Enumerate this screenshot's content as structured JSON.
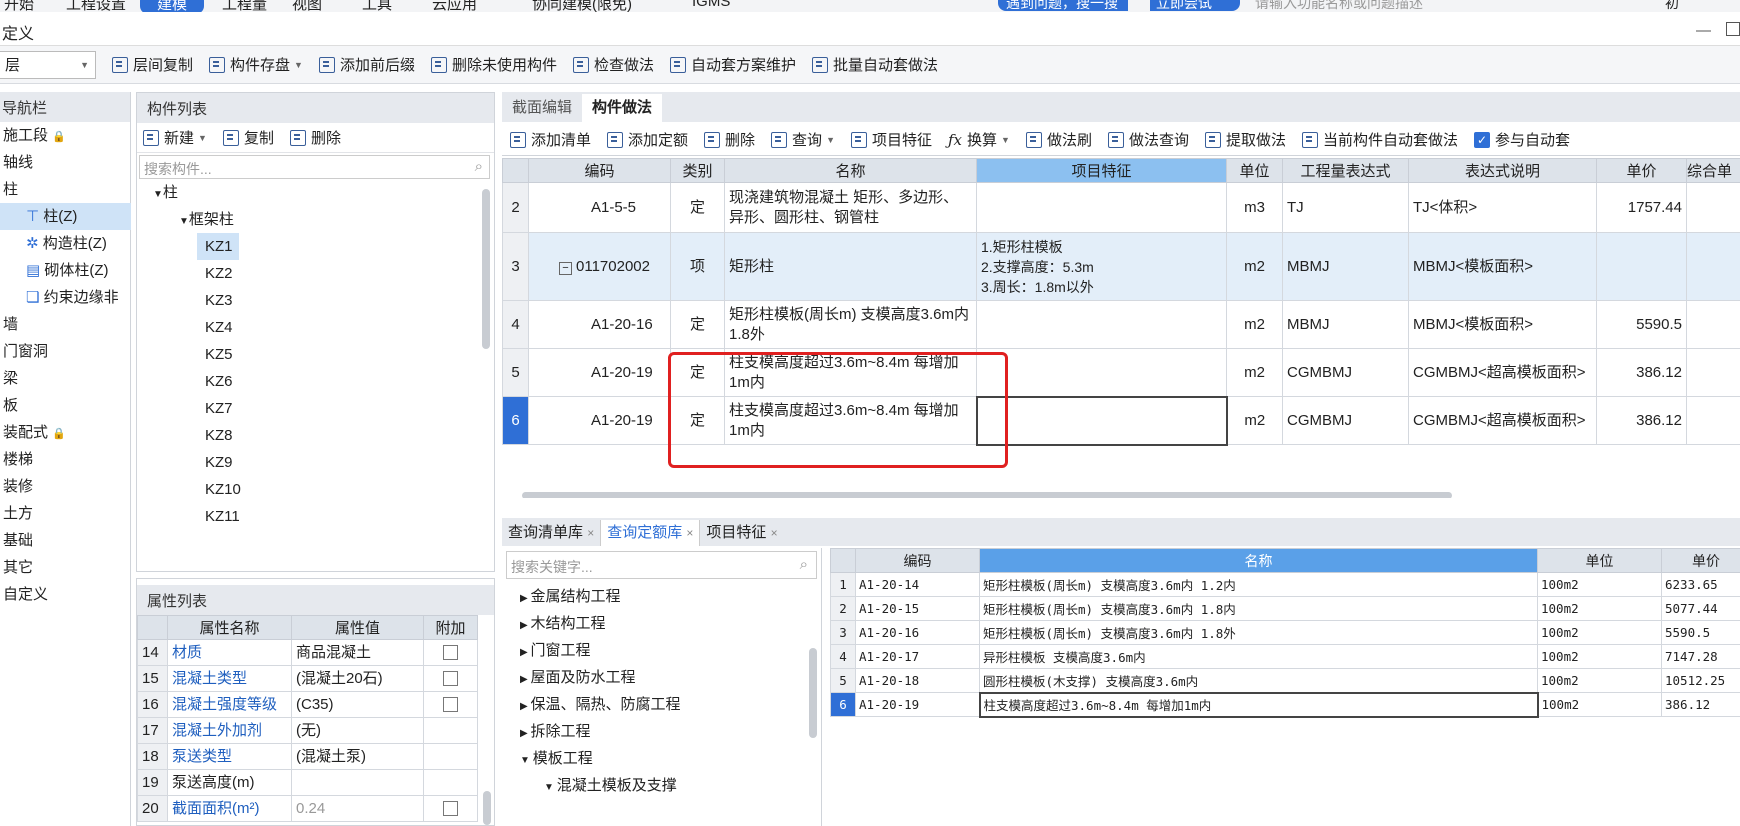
{
  "top_menu": {
    "items": [
      "开始",
      "工程设置",
      "建模",
      "工程量",
      "视图",
      "工具",
      "云应用",
      "协同建模(限免)",
      "IGMS"
    ],
    "active": "建模",
    "pill1": "遇到问题，搜一搜",
    "pill2": "立即尝试",
    "search_placeholder": "请输入功能名称或问题描述",
    "user": "初"
  },
  "title": "定义",
  "toolbar": {
    "floor": "层",
    "items": [
      "层间复制",
      "构件存盘",
      "添加前后缀",
      "删除未使用构件",
      "检查做法",
      "自动套方案维护",
      "批量自动套做法"
    ]
  },
  "nav": {
    "title": "导航栏",
    "items": [
      "施工段",
      "轴线",
      "柱",
      "柱(Z)",
      "构造柱(Z)",
      "砌体柱(Z)",
      "约束边缘非",
      "墙",
      "门窗洞",
      "梁",
      "板",
      "装配式",
      "楼梯",
      "装修",
      "土方",
      "基础",
      "其它",
      "自定义"
    ]
  },
  "comp_list": {
    "title": "构件列表",
    "new": "新建",
    "copy": "复制",
    "delete": "删除",
    "search_placeholder": "搜索构件...",
    "tree_root": "柱",
    "tree_group": "框架柱",
    "items": [
      "KZ1",
      "KZ2",
      "KZ3",
      "KZ4",
      "KZ5",
      "KZ6",
      "KZ7",
      "KZ8",
      "KZ9",
      "KZ10",
      "KZ11"
    ]
  },
  "props": {
    "title": "属性列表",
    "headers": [
      "属性名称",
      "属性值",
      "附加"
    ],
    "rows": [
      {
        "no": "14",
        "name": "材质",
        "value": "商品混凝土"
      },
      {
        "no": "15",
        "name": "混凝土类型",
        "value": "(混凝土20石)"
      },
      {
        "no": "16",
        "name": "混凝土强度等级",
        "value": "(C35)"
      },
      {
        "no": "17",
        "name": "混凝土外加剂",
        "value": "(无)"
      },
      {
        "no": "18",
        "name": "泵送类型",
        "value": "(混凝土泵)"
      },
      {
        "no": "19",
        "name": "泵送高度(m)",
        "value": ""
      },
      {
        "no": "20",
        "name": "截面面积(m²)",
        "value": "0.24"
      }
    ]
  },
  "work_tabs": [
    "截面编辑",
    "构件做法"
  ],
  "work_toolbar": [
    "添加清单",
    "添加定额",
    "删除",
    "查询",
    "项目特征",
    "换算",
    "做法刷",
    "做法查询",
    "提取做法",
    "当前构件自动套做法",
    "参与自动套"
  ],
  "grid": {
    "headers": [
      "编码",
      "类别",
      "名称",
      "项目特征",
      "单位",
      "工程量表达式",
      "表达式说明",
      "单价",
      "综合单"
    ],
    "rows": [
      {
        "no": "2",
        "code": "A1-5-5",
        "type": "定",
        "name": "现浇建筑物混凝土 矩形、多边形、异形、圆形柱、钢管柱",
        "feature": "",
        "unit": "m3",
        "expr": "TJ",
        "desc": "TJ<体积>",
        "price": "1757.44"
      },
      {
        "no": "3",
        "code": "011702002",
        "type": "项",
        "name": "矩形柱",
        "feature": "1.矩形柱模板\n2.支撑高度：5.3m\n3.周长：1.8m以外",
        "unit": "m2",
        "expr": "MBMJ",
        "desc": "MBMJ<模板面积>",
        "price": ""
      },
      {
        "no": "4",
        "code": "A1-20-16",
        "type": "定",
        "name": "矩形柱模板(周长m) 支模高度3.6m内 1.8外",
        "feature": "",
        "unit": "m2",
        "expr": "MBMJ",
        "desc": "MBMJ<模板面积>",
        "price": "5590.5"
      },
      {
        "no": "5",
        "code": "A1-20-19",
        "type": "定",
        "name": "柱支模高度超过3.6m~8.4m 每增加1m内",
        "feature": "",
        "unit": "m2",
        "expr": "CGMBMJ",
        "desc": "CGMBMJ<超高模板面积>",
        "price": "386.12"
      },
      {
        "no": "6",
        "code": "A1-20-19",
        "type": "定",
        "name": "柱支模高度超过3.6m~8.4m 每增加1m内",
        "feature": "",
        "unit": "m2",
        "expr": "CGMBMJ",
        "desc": "CGMBMJ<超高模板面积>",
        "price": "386.12"
      }
    ]
  },
  "bottom_tabs": [
    "查询清单库",
    "查询定额库",
    "项目特征"
  ],
  "quota": {
    "search_placeholder": "搜索关键字...",
    "tree": [
      "金属结构工程",
      "木结构工程",
      "门窗工程",
      "屋面及防水工程",
      "保温、隔热、防腐工程",
      "拆除工程",
      "模板工程",
      "混凝土模板及支撑"
    ],
    "headers": [
      "编码",
      "名称",
      "单位",
      "单价"
    ],
    "rows": [
      {
        "no": "1",
        "code": "A1-20-14",
        "name": "矩形柱模板(周长m) 支模高度3.6m内 1.2内",
        "unit": "100m2",
        "price": "6233.65"
      },
      {
        "no": "2",
        "code": "A1-20-15",
        "name": "矩形柱模板(周长m) 支模高度3.6m内 1.8内",
        "unit": "100m2",
        "price": "5077.44"
      },
      {
        "no": "3",
        "code": "A1-20-16",
        "name": "矩形柱模板(周长m) 支模高度3.6m内 1.8外",
        "unit": "100m2",
        "price": "5590.5"
      },
      {
        "no": "4",
        "code": "A1-20-17",
        "name": "异形柱模板 支模高度3.6m内",
        "unit": "100m2",
        "price": "7147.28"
      },
      {
        "no": "5",
        "code": "A1-20-18",
        "name": "圆形柱模板(木支撑) 支模高度3.6m内",
        "unit": "100m2",
        "price": "10512.25"
      },
      {
        "no": "6",
        "code": "A1-20-19",
        "name": "柱支模高度超过3.6m~8.4m 每增加1m内",
        "unit": "100m2",
        "price": "386.12"
      }
    ]
  },
  "colors": {
    "accent": "#2f6fd6",
    "highlight": "#cfe3f7",
    "annotation": "#e02020"
  }
}
